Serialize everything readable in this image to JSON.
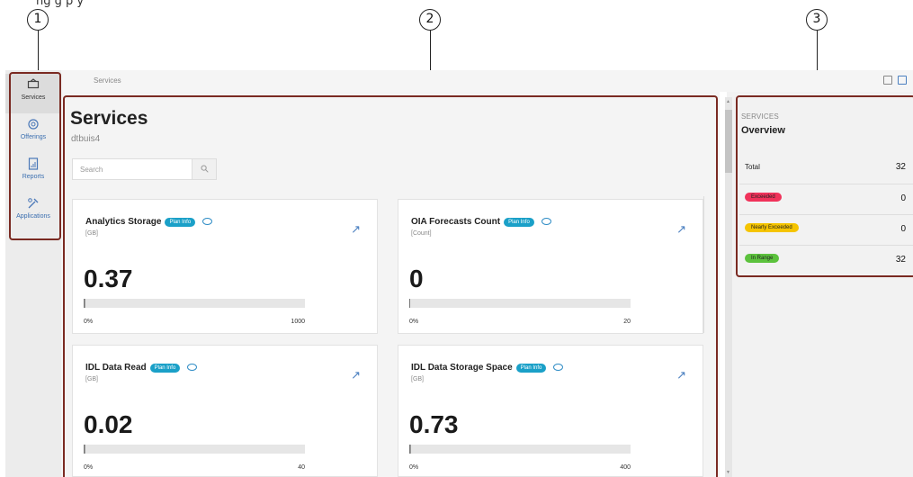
{
  "caption": "ng                       g         p      y",
  "callouts": [
    "1",
    "2",
    "3"
  ],
  "breadcrumb": "Services",
  "sidebar": {
    "items": [
      {
        "label": "Services",
        "icon": "services-icon"
      },
      {
        "label": "Offerings",
        "icon": "offerings-icon"
      },
      {
        "label": "Reports",
        "icon": "reports-icon"
      },
      {
        "label": "Applications",
        "icon": "applications-icon"
      }
    ]
  },
  "main": {
    "title": "Services",
    "subtitle": "dtbuis4",
    "search_placeholder": "Search",
    "badge_label": "Plan Info",
    "cards": [
      {
        "name": "Analytics Storage",
        "unit": "[GB]",
        "value": "0.37",
        "min": "0%",
        "max": "1000",
        "fill_fraction": 0.0004
      },
      {
        "name": "OIA Forecasts Count",
        "unit": "[Count]",
        "value": "0",
        "min": "0%",
        "max": "20",
        "fill_fraction": 0.0
      },
      {
        "name": "IDL Data Read",
        "unit": "[GB]",
        "value": "0.02",
        "min": "0%",
        "max": "40",
        "fill_fraction": 0.0005
      },
      {
        "name": "IDL Data Storage Space",
        "unit": "[GB]",
        "value": "0.73",
        "min": "0%",
        "max": "400",
        "fill_fraction": 0.0018
      }
    ]
  },
  "overview": {
    "eyebrow": "SERVICES",
    "title": "Overview",
    "rows": [
      {
        "label": "Total",
        "count": "32",
        "pill": false,
        "color": ""
      },
      {
        "label": "Exceeded",
        "count": "0",
        "pill": true,
        "color": "#f0325a"
      },
      {
        "label": "Nearly Exceeded",
        "count": "0",
        "pill": true,
        "color": "#f5c400"
      },
      {
        "label": "In Range",
        "count": "32",
        "pill": true,
        "color": "#5cc23d"
      }
    ]
  }
}
